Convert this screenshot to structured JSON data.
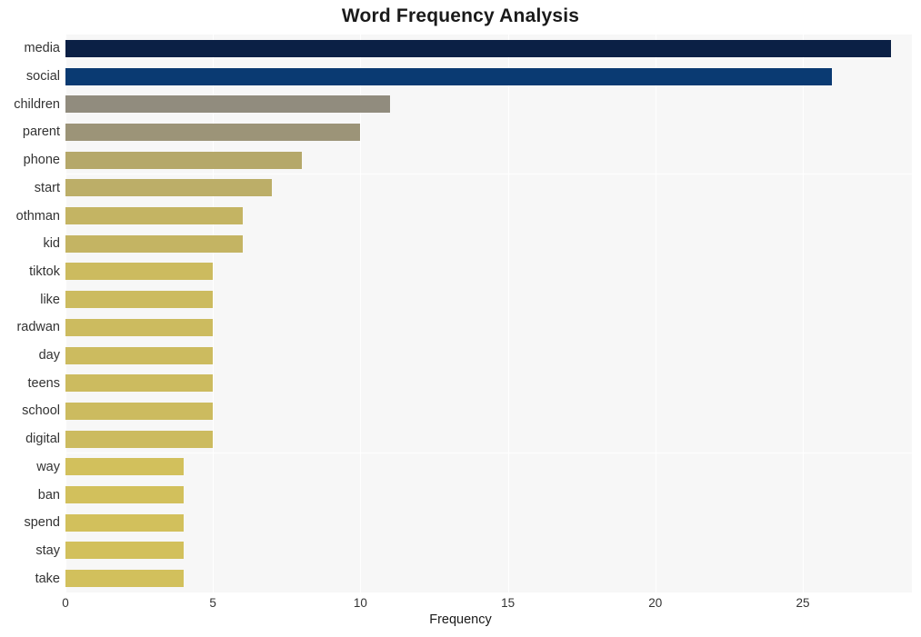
{
  "chart_data": {
    "type": "bar",
    "orientation": "horizontal",
    "title": "Word Frequency Analysis",
    "xlabel": "Frequency",
    "ylabel": "",
    "xlim": [
      0,
      28.7
    ],
    "xticks": [
      0,
      5,
      10,
      15,
      20,
      25
    ],
    "grid": true,
    "legend": null,
    "categories": [
      "media",
      "social",
      "children",
      "parent",
      "phone",
      "start",
      "othman",
      "kid",
      "tiktok",
      "like",
      "radwan",
      "day",
      "teens",
      "school",
      "digital",
      "way",
      "ban",
      "spend",
      "stay",
      "take"
    ],
    "values": [
      28,
      26,
      11,
      10,
      8,
      7,
      6,
      6,
      5,
      5,
      5,
      5,
      5,
      5,
      5,
      4,
      4,
      4,
      4,
      4
    ],
    "bar_colors": [
      "#0b2045",
      "#0a3a72",
      "#918c7e",
      "#9c9478",
      "#b5a86a",
      "#bcae68",
      "#c4b463",
      "#c4b463",
      "#ccbb5f",
      "#ccbb5f",
      "#ccbb5f",
      "#ccbb5f",
      "#ccbb5f",
      "#ccbb5f",
      "#ccbb5f",
      "#d2c05c",
      "#d2c05c",
      "#d2c05c",
      "#d2c05c",
      "#d2c05c"
    ],
    "plot_background": "#f7f7f7",
    "page_background": "#ffffff"
  }
}
